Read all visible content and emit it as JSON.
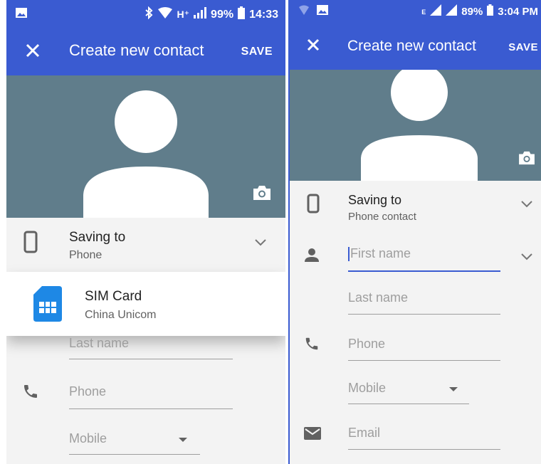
{
  "left": {
    "status": {
      "battery": "99%",
      "time": "14:33",
      "network": "H⁺"
    },
    "appbar": {
      "title": "Create new contact",
      "save": "SAVE"
    },
    "saving": {
      "label": "Saving to",
      "value": "Phone"
    },
    "popup": {
      "name": "SIM Card",
      "carrier": "China Unicom"
    },
    "fields": {
      "last_name": "Last name",
      "phone": "Phone",
      "type": "Mobile"
    }
  },
  "right": {
    "status": {
      "battery": "89%",
      "time": "3:04 PM",
      "sim_mark": "E"
    },
    "appbar": {
      "title": "Create new contact",
      "save": "SAVE"
    },
    "saving": {
      "label": "Saving to",
      "value": "Phone contact"
    },
    "fields": {
      "first_name": "First name",
      "last_name": "Last name",
      "phone": "Phone",
      "type": "Mobile",
      "email": "Email"
    }
  },
  "colors": {
    "primary": "#3a5bd1",
    "hero": "#607d8b",
    "sim_blue": "#1e88e5"
  },
  "icons": [
    "close-icon",
    "camera-icon",
    "phone-device-icon",
    "chevron-down-icon",
    "sim-card-icon",
    "person-icon",
    "call-icon",
    "email-icon",
    "dropdown-arrow-icon"
  ]
}
